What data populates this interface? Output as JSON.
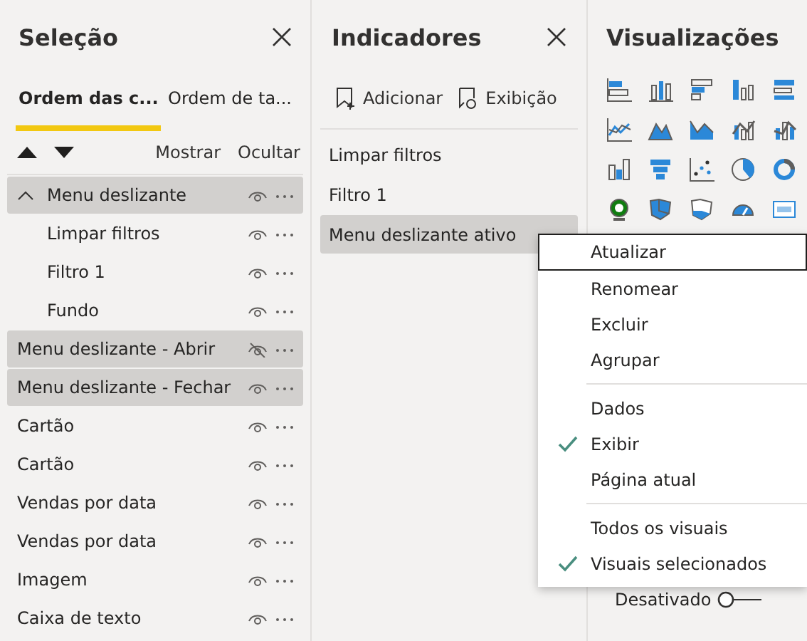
{
  "selection_pane": {
    "title": "Seleção",
    "tabs": [
      {
        "label": "Ordem das c...",
        "selected": true
      },
      {
        "label": "Ordem de ta...",
        "selected": false
      }
    ],
    "actions": [
      "Mostrar",
      "Ocultar"
    ],
    "layers": [
      {
        "label": "Menu deslizante",
        "selected": true,
        "visible": true,
        "expanded": true,
        "children": [
          {
            "label": "Limpar filtros",
            "selected": false,
            "visible": true
          },
          {
            "label": "Filtro 1",
            "selected": false,
            "visible": true
          },
          {
            "label": "Fundo",
            "selected": false,
            "visible": true
          }
        ]
      },
      {
        "label": "Menu deslizante - Abrir",
        "selected": true,
        "visible": false
      },
      {
        "label": "Menu deslizante - Fechar",
        "selected": true,
        "visible": true
      },
      {
        "label": "Cartão",
        "selected": false,
        "visible": true
      },
      {
        "label": "Cartão",
        "selected": false,
        "visible": true
      },
      {
        "label": "Vendas por data",
        "selected": false,
        "visible": true
      },
      {
        "label": "Vendas por data",
        "selected": false,
        "visible": true
      },
      {
        "label": "Imagem",
        "selected": false,
        "visible": true
      },
      {
        "label": "Caixa de texto",
        "selected": false,
        "visible": true
      }
    ]
  },
  "bookmarks_pane": {
    "title": "Indicadores",
    "toolbar": [
      "Adicionar",
      "Exibição"
    ],
    "bookmarks": [
      {
        "label": "Limpar filtros",
        "selected": false
      },
      {
        "label": "Filtro 1",
        "selected": false
      },
      {
        "label": "Menu deslizante ativo",
        "selected": true
      }
    ]
  },
  "visualizations_pane": {
    "title": "Visualizações",
    "toggle": {
      "label": "Desativado",
      "on": false
    }
  },
  "context_menu": {
    "sections": [
      [
        {
          "label": "Atualizar",
          "checked": false,
          "focused": true
        },
        {
          "label": "Renomear",
          "checked": false,
          "focused": false
        },
        {
          "label": "Excluir",
          "checked": false,
          "focused": false
        },
        {
          "label": "Agrupar",
          "checked": false,
          "focused": false
        }
      ],
      [
        {
          "label": "Dados",
          "checked": false,
          "focused": false
        },
        {
          "label": "Exibir",
          "checked": true,
          "focused": false
        },
        {
          "label": "Página atual",
          "checked": false,
          "focused": false
        }
      ],
      [
        {
          "label": "Todos os visuais",
          "checked": false,
          "focused": false
        },
        {
          "label": "Visuais selecionados",
          "checked": true,
          "focused": false
        }
      ]
    ]
  }
}
